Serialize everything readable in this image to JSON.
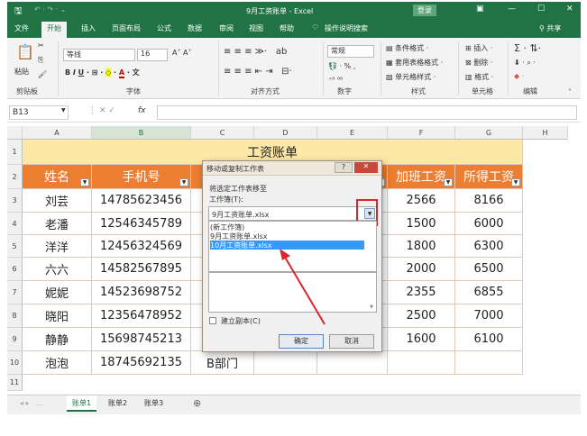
{
  "window": {
    "title": "9月工资账单 - Excel",
    "login": "登录"
  },
  "tabs": [
    "文件",
    "开始",
    "插入",
    "页面布局",
    "公式",
    "数据",
    "审阅",
    "视图",
    "帮助"
  ],
  "search": "操作说明搜索",
  "share": "共享",
  "ribbon": {
    "font_name": "等线",
    "font_size": "16",
    "number_format": "常规",
    "groups": [
      "剪贴板",
      "字体",
      "对齐方式",
      "数字",
      "样式",
      "单元格",
      "编辑"
    ],
    "paste": "粘贴",
    "cond_format": "条件格式",
    "table_format": "套用表格格式",
    "cell_style": "单元格样式",
    "insert": "插入",
    "delete": "删除",
    "format": "格式"
  },
  "formula_bar": {
    "name_box": "B13",
    "fx": "fx",
    "value": ""
  },
  "columns": [
    "A",
    "B",
    "C",
    "D",
    "E",
    "F",
    "G",
    "H"
  ],
  "rows": [
    "1",
    "2",
    "3",
    "4",
    "5",
    "6",
    "7",
    "8",
    "9",
    "10",
    "11"
  ],
  "sheet": {
    "title": "工资账单",
    "headers": {
      "A": "姓名",
      "B": "手机号",
      "F": "加班工资",
      "G": "所得工资"
    },
    "data": [
      {
        "name": "刘芸",
        "phone": "14785623456",
        "f": "2566",
        "g": "8166"
      },
      {
        "name": "老潘",
        "phone": "12546345789",
        "f": "1500",
        "g": "6000"
      },
      {
        "name": "洋洋",
        "phone": "12456324569",
        "f": "1800",
        "g": "6300"
      },
      {
        "name": "六六",
        "phone": "14582567895",
        "f": "2000",
        "g": "6500"
      },
      {
        "name": "妮妮",
        "phone": "14523698752",
        "f": "2355",
        "g": "6855"
      },
      {
        "name": "晓阳",
        "phone": "12356478952",
        "f": "2500",
        "g": "7000"
      },
      {
        "name": "静静",
        "phone": "15698745213",
        "f": "1600",
        "g": "6100"
      },
      {
        "name": "泡泡",
        "phone": "18745692135",
        "c": "B部门"
      }
    ]
  },
  "sheet_tabs": [
    "账单1",
    "账单2",
    "账单3"
  ],
  "dialog": {
    "title": "移动或复制工作表",
    "help": "?",
    "close": "✕",
    "move_to_label": "将选定工作表移至",
    "workbook_label": "工作簿(T):",
    "workbook_value": "9月工资账单.xlsx",
    "options": [
      "(新工作簿)",
      "9月工资账单.xlsx",
      "10月工资账单.xlsx"
    ],
    "selected_index": 2,
    "copy_label": "建立副本(C)",
    "ok": "确定",
    "cancel": "取消"
  },
  "colors": {
    "excel_green": "#217346",
    "header_orange": "#ed7d31",
    "title_fill": "#fde8a8",
    "highlight": "#3399ff",
    "annotation_red": "#d9262c"
  }
}
